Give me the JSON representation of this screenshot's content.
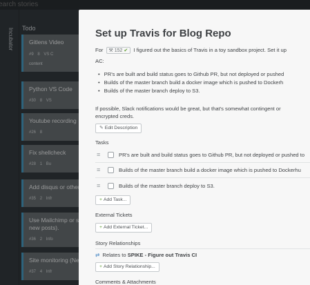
{
  "search": {
    "placeholder": "earch stories"
  },
  "sidebar": {
    "label": "Incubator"
  },
  "column": {
    "title": "Todo"
  },
  "cards": [
    {
      "title": "Gitlens Video",
      "id": "#9",
      "est": "8",
      "extra": "VS C",
      "tag": "content"
    },
    {
      "title": "Python VS Code",
      "id": "#30",
      "est": "8",
      "extra": "VS",
      "tag": ""
    },
    {
      "title": "Youtube recording",
      "id": "#26",
      "est": "8",
      "extra": "",
      "tag": ""
    },
    {
      "title": "Fix shellcheck",
      "id": "#28",
      "est": "1",
      "extra": "Bu",
      "tag": ""
    },
    {
      "title": "Add disqus or other",
      "id": "#35",
      "est": "2",
      "extra": "Infr",
      "tag": ""
    },
    {
      "title": "Use Mailchimp or s for new posts).",
      "id": "#36",
      "est": "2",
      "extra": "Info",
      "tag": ""
    },
    {
      "title": "Site monitoring (Ne",
      "id": "#37",
      "est": "4",
      "extra": "Infr",
      "tag": ""
    }
  ],
  "modal": {
    "title": "Set up Travis for Blog Repo",
    "for_label": "For",
    "story_id": "152",
    "desc_line1": "I figured out the basics of Travis in a toy sandbox project. Set it up",
    "ac_label": "AC:",
    "bullets": [
      "PR's are built and build status goes to Github PR, but not deployed or pushed",
      "Builds of the master branch build a docker image which is pushed to Dockerh",
      "Builds of the master branch deploy to S3."
    ],
    "desc_line2": "If possible, Slack notifications would be great, but that's somewhat contingent or",
    "desc_line3": "encrypted creds.",
    "edit_description": "Edit Description",
    "tasks_label": "Tasks",
    "tasks": [
      "PR's are built and build status goes to Github PR, but not deployed or pushed to",
      "Builds of the master branch build a docker image which is pushed to Dockerhu",
      "Builds of the master branch deploy to S3."
    ],
    "add_task": "Add Task...",
    "external_tickets_label": "External Tickets",
    "add_external_ticket": "Add External Ticket...",
    "story_relationships_label": "Story Relationships",
    "relates_prefix": "Relates to",
    "relates_story": "SPIKE - Figure out Travis CI",
    "add_story_relationship": "Add Story Relationship...",
    "comments_label": "Comments & Attachments"
  },
  "colors": {
    "card_accent": "#4aa0c8",
    "link_blue": "#3a7fc0",
    "badge_green": "#5c9a2f"
  },
  "icons": {
    "id_badge": "wrench-icon",
    "check": "check-circle-icon",
    "edit": "pencil-icon",
    "add": "plus-icon",
    "relation": "arrows-icon",
    "drag": "drag-handle-icon"
  }
}
